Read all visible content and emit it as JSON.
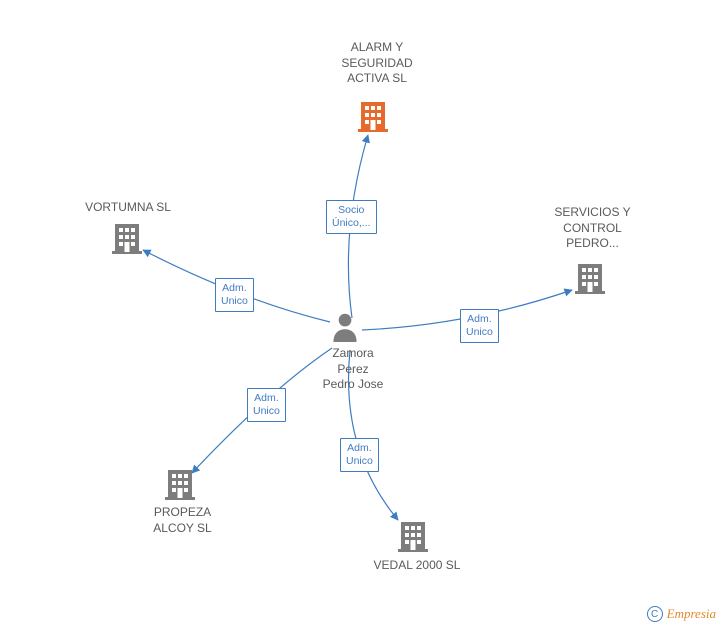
{
  "center": {
    "name": "Zamora\nPerez\nPedro Jose"
  },
  "nodes": [
    {
      "id": "alarm",
      "label": "ALARM Y\nSEGURIDAD\nACTIVA SL",
      "highlighted": true,
      "color": "#e56a2b"
    },
    {
      "id": "servicios",
      "label": "SERVICIOS Y\nCONTROL\nPEDRO...",
      "highlighted": false,
      "color": "#7d7d7d"
    },
    {
      "id": "vedal",
      "label": "VEDAL 2000 SL",
      "highlighted": false,
      "color": "#7d7d7d"
    },
    {
      "id": "propeza",
      "label": "PROPEZA\nALCOY SL",
      "highlighted": false,
      "color": "#7d7d7d"
    },
    {
      "id": "vortumna",
      "label": "VORTUMNA SL",
      "highlighted": false,
      "color": "#7d7d7d"
    }
  ],
  "edges": [
    {
      "to": "alarm",
      "label": "Socio\nÚnico,..."
    },
    {
      "to": "servicios",
      "label": "Adm.\nUnico"
    },
    {
      "to": "vedal",
      "label": "Adm.\nUnico"
    },
    {
      "to": "propeza",
      "label": "Adm.\nUnico"
    },
    {
      "to": "vortumna",
      "label": "Adm.\nUnico"
    }
  ],
  "footer": {
    "copyright_symbol": "C",
    "brand": "Empresia"
  }
}
